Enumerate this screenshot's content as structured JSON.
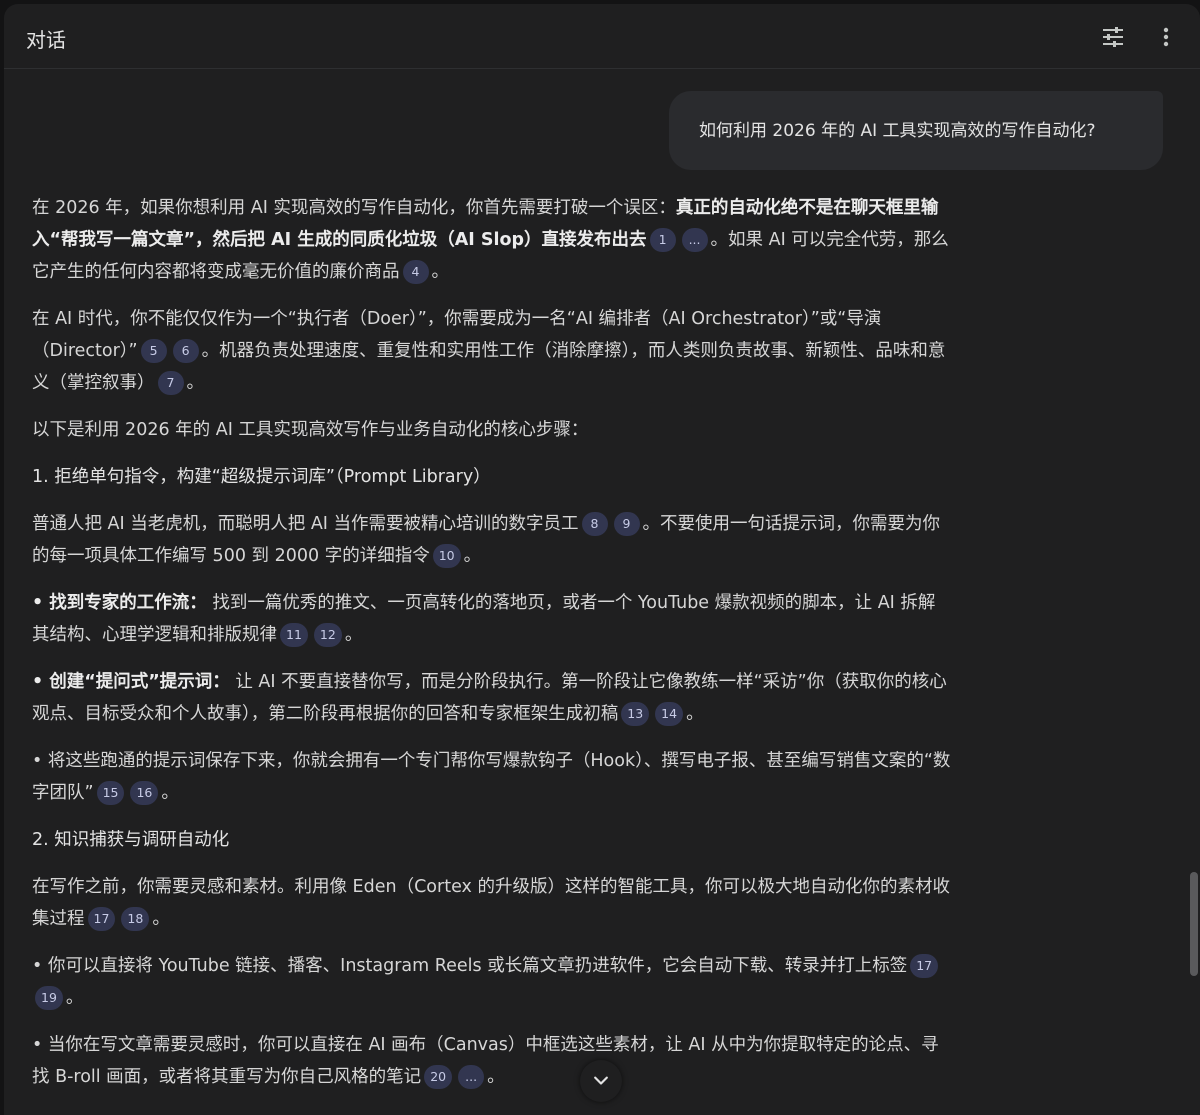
{
  "header": {
    "title": "对话"
  },
  "user_message": "如何利用 2026 年的 AI 工具实现高效的写作自动化?",
  "paragraphs": {
    "p1": {
      "a": "在 2026 年，如果你想利用 AI 实现高效的写作自动化，你首先需要打破一个误区：",
      "b": "真正的自动化绝不是在聊天框里输入“帮我写一篇文章”，然后把 AI 生成的同质化垃圾（AI Slop）直接发布出去",
      "c": "。如果 AI 可以完全代劳，那么它产生的任何内容都将变成毫无价值的廉价商品",
      "d": "。",
      "cite1": "1",
      "cite2": "...",
      "cite3": "4"
    },
    "p2": {
      "a": "在 AI 时代，你不能仅仅作为一个“执行者（Doer）”，你需要成为一名“AI 编排者（AI Orchestrator）”或“导演（Director）”",
      "b": "。机器负责处理速度、重复性和实用性工作（消除摩擦），而人类则负责故事、新颖性、品味和意义（掌控叙事）",
      "c": "。",
      "cite1": "5",
      "cite2": "6",
      "cite3": "7"
    },
    "p3": "以下是利用 2026 年的 AI 工具实现高效写作与业务自动化的核心步骤：",
    "h1": "1. 拒绝单句指令，构建“超级提示词库”（Prompt Library）",
    "p4": {
      "a": "普通人把 AI 当老虎机，而聪明人把 AI 当作需要被精心培训的数字员工",
      "b": "。不要使用一句话提示词，你需要为你的每一项具体工作编写 500 到 2000 字的详细指令",
      "c": "。",
      "cite1": "8",
      "cite2": "9",
      "cite3": "10"
    },
    "b1": {
      "bullet": "• ",
      "bold": "找到专家的工作流：",
      "a": " 找到一篇优秀的推文、一页高转化的落地页，或者一个 YouTube 爆款视频的脚本，让 AI 拆解其结构、心理学逻辑和排版规律",
      "b": "。",
      "cite1": "11",
      "cite2": "12"
    },
    "b2": {
      "bullet": "• ",
      "bold": "创建“提问式”提示词：",
      "a": " 让 AI 不要直接替你写，而是分阶段执行。第一阶段让它像教练一样“采访”你（获取你的核心观点、目标受众和个人故事），第二阶段再根据你的回答和专家框架生成初稿",
      "b": "。",
      "cite1": "13",
      "cite2": "14"
    },
    "b3": {
      "a": "• 将这些跑通的提示词保存下来，你就会拥有一个专门帮你写爆款钩子（Hook）、撰写电子报、甚至编写销售文案的“数字团队”",
      "b": "。",
      "cite1": "15",
      "cite2": "16"
    },
    "h2": "2. 知识捕获与调研自动化",
    "p5": {
      "a": "在写作之前，你需要灵感和素材。利用像 Eden（Cortex 的升级版）这样的智能工具，你可以极大地自动化你的素材收集过程",
      "b": "。",
      "cite1": "17",
      "cite2": "18"
    },
    "b4": {
      "a": "• 你可以直接将 YouTube 链接、播客、Instagram Reels 或长篇文章扔进软件，它会自动下载、转录并打上标签",
      "b": "。",
      "cite1": "17",
      "cite2": "19"
    },
    "b5": {
      "a": "• 当你在写文章需要灵感时，你可以直接在 AI 画布（Canvas）中框选这些素材，让 AI 从中为你提取特定的论点、寻找 B-roll 画面，或者将其重写为你自己风格的笔记",
      "b": "。",
      "cite1": "20",
      "cite2": "..."
    }
  },
  "icons": {
    "tune": "tune-icon",
    "more": "more-vert-icon",
    "scroll": "chevron-down-icon"
  }
}
